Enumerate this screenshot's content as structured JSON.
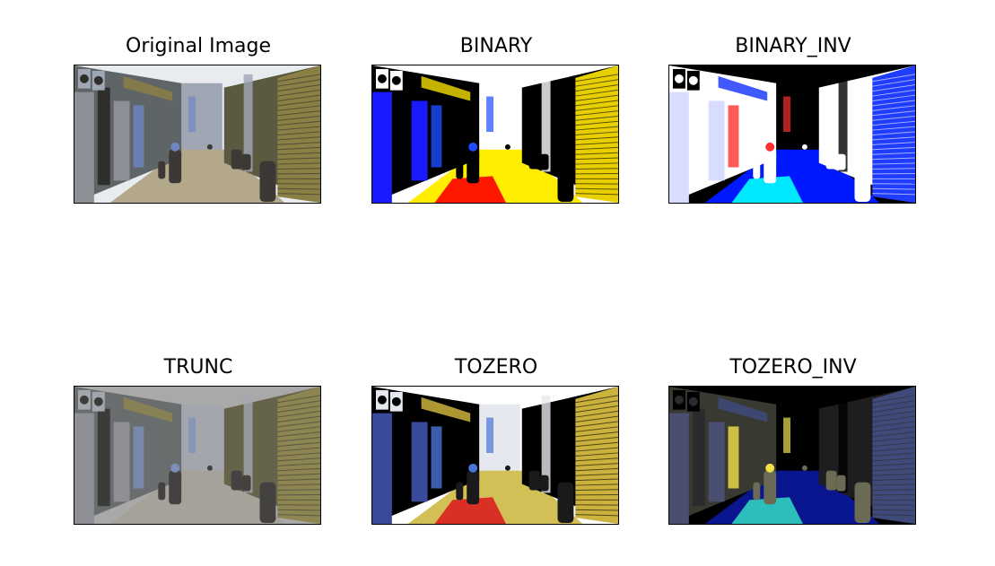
{
  "panels": [
    {
      "title": "Original Image",
      "variant": "original"
    },
    {
      "title": "BINARY",
      "variant": "binary"
    },
    {
      "title": "BINARY_INV",
      "variant": "binary_inv"
    },
    {
      "title": "TRUNC",
      "variant": "trunc"
    },
    {
      "title": "TOZERO",
      "variant": "tozero"
    },
    {
      "title": "TOZERO_INV",
      "variant": "tozero_inv"
    }
  ]
}
